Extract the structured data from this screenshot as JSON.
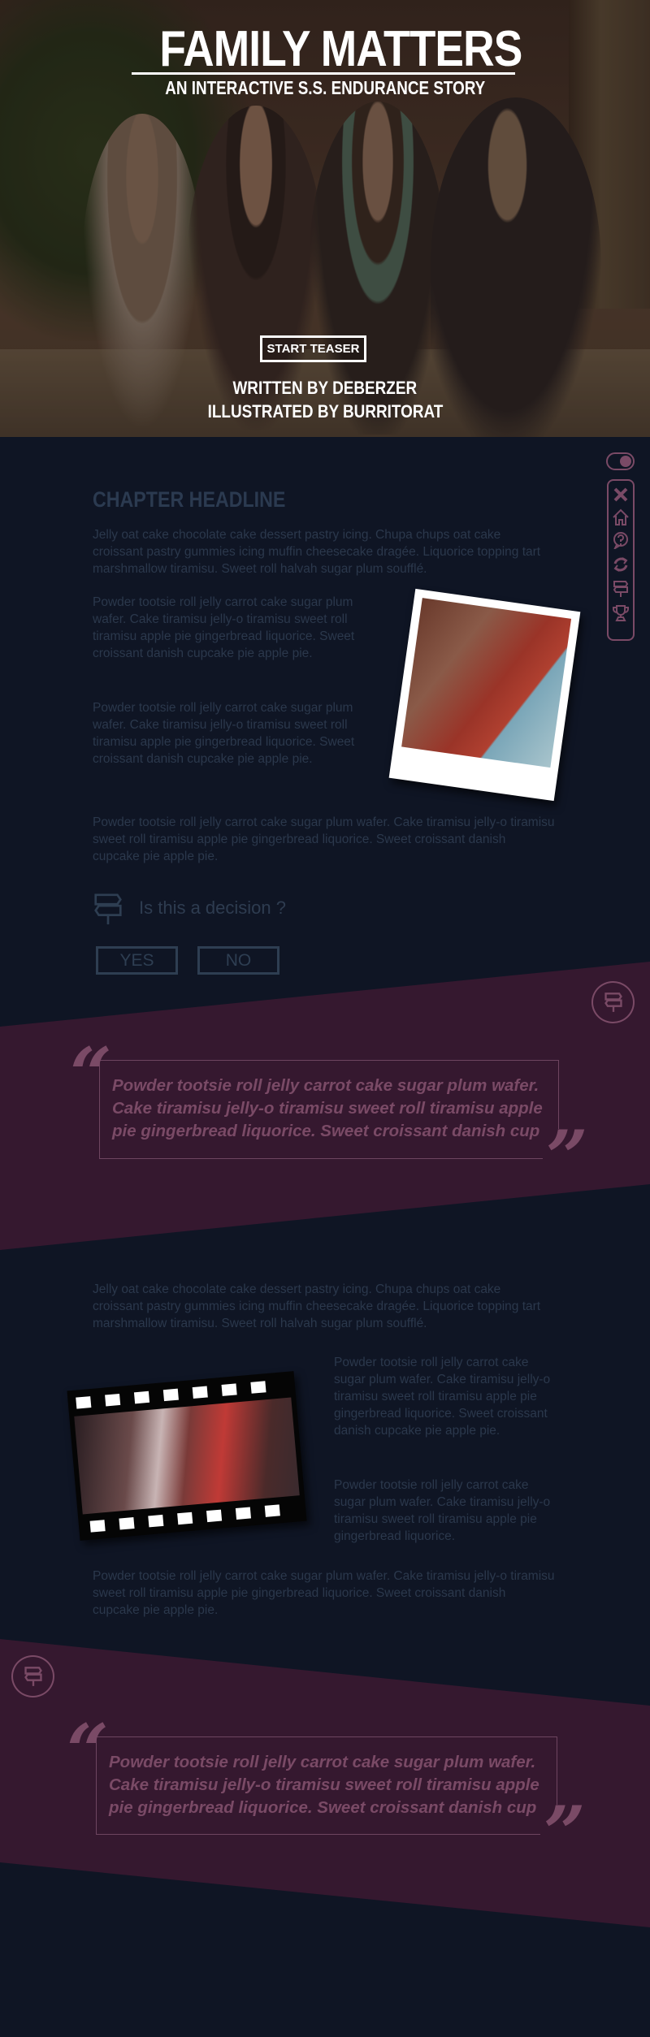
{
  "hero": {
    "title": "FAMILY MATTERS",
    "subtitle": "AN INTERACTIVE S.S. ENDURANCE STORY",
    "start_button": "START TEASER",
    "written_by": "WRITTEN BY DEBERZER",
    "illustrated_by": "ILLUSTRATED BY BURRITORAT"
  },
  "sidebar": {
    "icons": [
      "toggle-icon",
      "close-icon",
      "home-icon",
      "help-icon",
      "refresh-icon",
      "signpost-icon",
      "trophy-icon"
    ],
    "accent": "#7a4a66"
  },
  "chapter": {
    "headline": "CHAPTER HEADLINE",
    "paragraphs": [
      "Jelly oat cake chocolate cake dessert pastry icing. Chupa chups oat cake croissant pastry gummies icing muffin cheesecake dragée. Liquorice topping tart marshmallow tiramisu. Sweet roll halvah sugar plum soufflé.",
      "Powder tootsie roll jelly carrot cake sugar plum wafer. Cake tiramisu jelly-o tiramisu sweet roll tiramisu apple pie gingerbread liquorice. Sweet croissant danish cupcake pie apple pie.",
      "Powder tootsie roll jelly carrot cake sugar plum wafer. Cake tiramisu jelly-o tiramisu sweet roll tiramisu apple pie gingerbread liquorice. Sweet croissant danish cupcake pie apple pie.",
      "Powder tootsie roll jelly carrot cake sugar plum wafer. Cake tiramisu jelly-o tiramisu sweet roll tiramisu apple pie gingerbread liquorice. Sweet croissant danish cupcake pie apple pie."
    ],
    "decision": {
      "question": "Is this a decision ?",
      "yes": "YES",
      "no": "NO"
    }
  },
  "quote1": {
    "open": "“",
    "close": "”",
    "text": "Powder tootsie roll jelly carrot cake sugar plum wafer. Cake tiramisu jelly-o tiramisu sweet roll tiramisu apple pie gingerbread liquorice. Sweet croissant danish cup"
  },
  "section2": {
    "paragraphs": [
      "Jelly oat cake chocolate cake dessert pastry icing. Chupa chups oat cake croissant pastry gummies icing muffin cheesecake dragée. Liquorice topping tart marshmallow tiramisu. Sweet roll halvah sugar plum soufflé.",
      "Powder tootsie roll jelly carrot cake sugar plum wafer. Cake tiramisu jelly-o tiramisu sweet roll tiramisu apple pie gingerbread liquorice. Sweet croissant danish cupcake pie apple pie.",
      "Powder tootsie roll jelly carrot cake sugar plum wafer. Cake tiramisu jelly-o tiramisu sweet roll tiramisu apple pie gingerbread liquorice.",
      "Powder tootsie roll jelly carrot cake sugar plum wafer. Cake tiramisu jelly-o tiramisu sweet roll tiramisu apple pie gingerbread liquorice. Sweet croissant danish cupcake pie apple pie."
    ]
  },
  "quote2": {
    "open": "“",
    "close": "”",
    "text": "Powder tootsie roll jelly carrot cake sugar plum wafer. Cake tiramisu jelly-o tiramisu sweet roll tiramisu apple pie gingerbread liquorice. Sweet croissant danish cup"
  },
  "colors": {
    "background": "#0f1524",
    "band": "#35182f",
    "text": "#2b384c",
    "accent": "#7a4a66"
  }
}
